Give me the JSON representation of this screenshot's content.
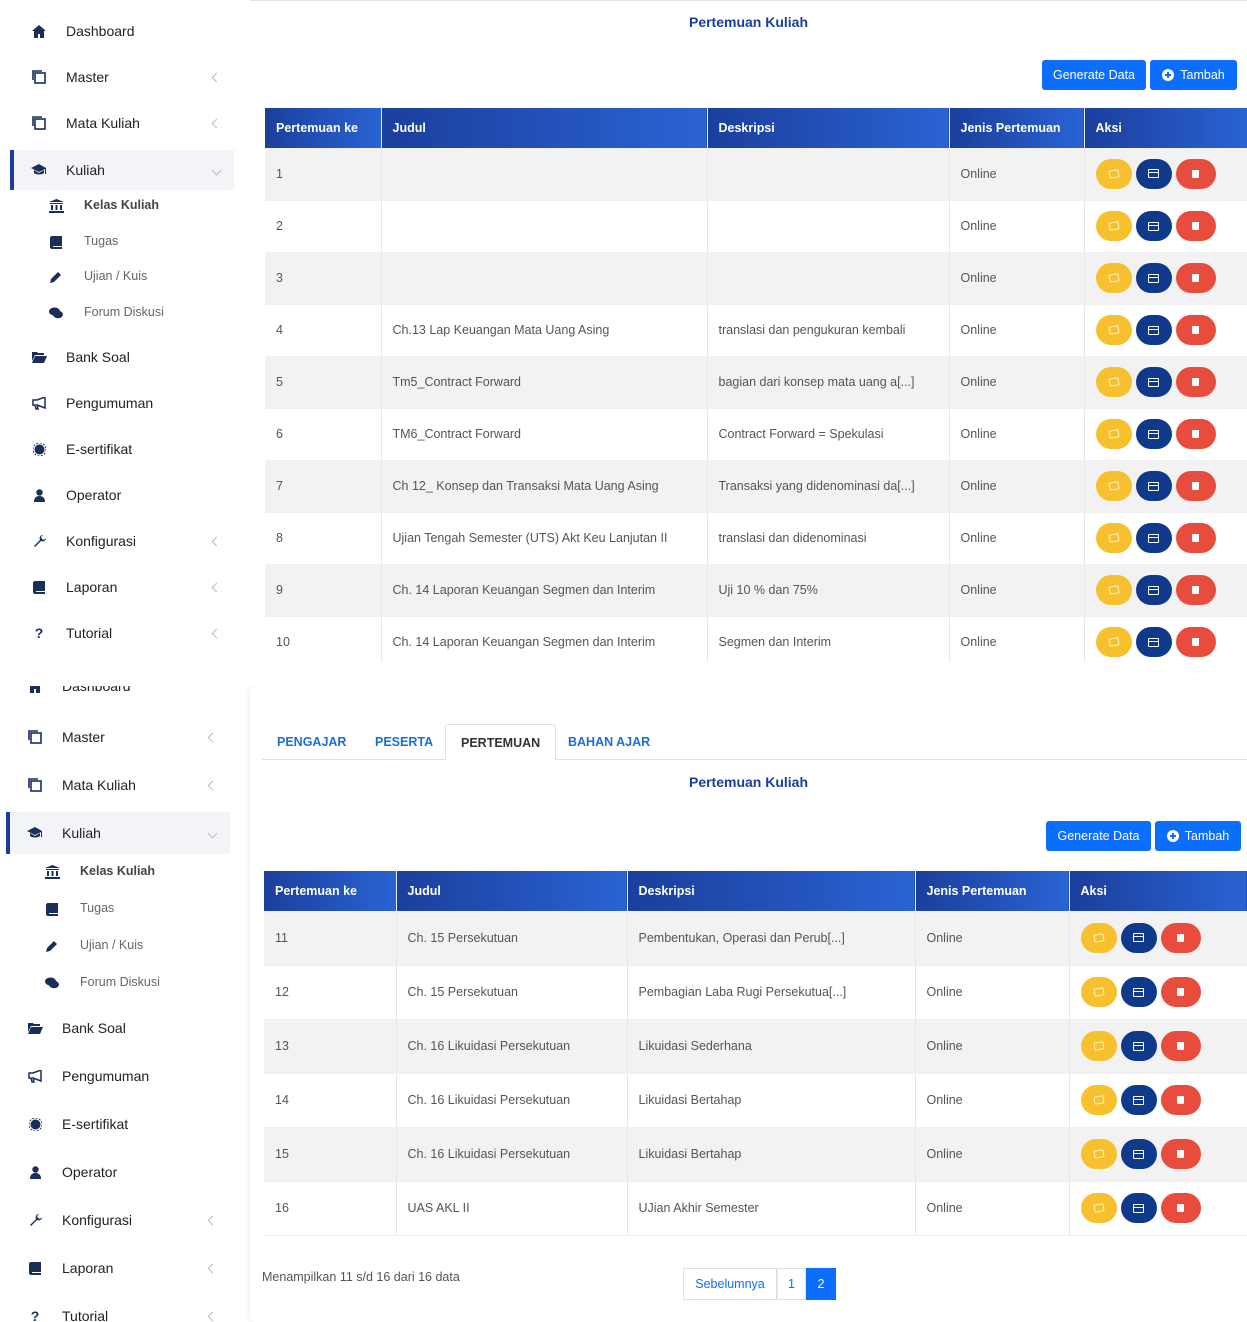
{
  "sidebar": {
    "items": {
      "dashboard": "Dashboard",
      "master": "Master",
      "mata_kuliah": "Mata Kuliah",
      "kuliah": "Kuliah",
      "kelas_kuliah": "Kelas Kuliah",
      "tugas": "Tugas",
      "ujian_kuis": "Ujian / Kuis",
      "forum_diskusi": "Forum Diskusi",
      "bank_soal": "Bank Soal",
      "pengumuman": "Pengumuman",
      "e_sertifikat": "E-sertifikat",
      "operator": "Operator",
      "konfigurasi": "Konfigurasi",
      "laporan": "Laporan",
      "tutorial": "Tutorial"
    }
  },
  "tabs": [
    "PENGAJAR",
    "PESERTA",
    "PERTEMUAN",
    "BAHAN AJAR"
  ],
  "active_tab": "PERTEMUAN",
  "section_title": "Pertemuan Kuliah",
  "buttons": {
    "generate": "Generate Data",
    "tambah": "Tambah"
  },
  "table": {
    "headers": [
      "Pertemuan ke",
      "Judul",
      "Deskripsi",
      "Jenis Pertemuan",
      "Aksi"
    ],
    "page1": [
      [
        "1",
        "",
        "",
        "Online"
      ],
      [
        "2",
        "",
        "",
        "Online"
      ],
      [
        "3",
        "",
        "",
        "Online"
      ],
      [
        "4",
        "Ch.13 Lap Keuangan Mata Uang Asing",
        "translasi dan pengukuran kembali",
        "Online"
      ],
      [
        "5",
        "Tm5_Contract Forward",
        "bagian dari konsep mata uang a[...]",
        "Online"
      ],
      [
        "6",
        "TM6_Contract Forward",
        "Contract Forward = Spekulasi",
        "Online"
      ],
      [
        "7",
        "Ch 12_ Konsep dan Transaksi Mata Uang Asing",
        "Transaksi yang didenominasi da[...]",
        "Online"
      ],
      [
        "8",
        "Ujian Tengah Semester (UTS) Akt Keu Lanjutan II",
        "translasi dan didenominasi",
        "Online"
      ],
      [
        "9",
        "Ch. 14 Laporan Keuangan Segmen dan Interim",
        "Uji 10 % dan 75%",
        "Online"
      ],
      [
        "10",
        "Ch. 14 Laporan Keuangan Segmen dan Interim",
        "Segmen dan Interim",
        "Online"
      ]
    ],
    "page2": [
      [
        "11",
        "Ch. 15 Persekutuan",
        "Pembentukan, Operasi dan Perub[...]",
        "Online"
      ],
      [
        "12",
        "Ch. 15 Persekutuan",
        "Pembagian Laba Rugi Persekutua[...]",
        "Online"
      ],
      [
        "13",
        "Ch. 16 Likuidasi Persekutuan",
        "Likuidasi Sederhana",
        "Online"
      ],
      [
        "14",
        "Ch. 16 Likuidasi Persekutuan",
        "Likuidasi Bertahap",
        "Online"
      ],
      [
        "15",
        "Ch. 16 Likuidasi Persekutuan",
        "Likuidasi Bertahap",
        "Online"
      ],
      [
        "16",
        "UAS AKL II",
        "UJian Akhir Semester",
        "Online"
      ]
    ]
  },
  "pagination": {
    "info": "Menampilkan 11 s/d 16 dari 16 data",
    "prev": "Sebelumnya",
    "pages": [
      "1",
      "2"
    ],
    "current": "2"
  },
  "colors": {
    "primary": "#0d6efd",
    "header": "#1b3f9c",
    "edit": "#f6c02e",
    "detail": "#0f3a8c",
    "delete": "#e74c3c"
  }
}
